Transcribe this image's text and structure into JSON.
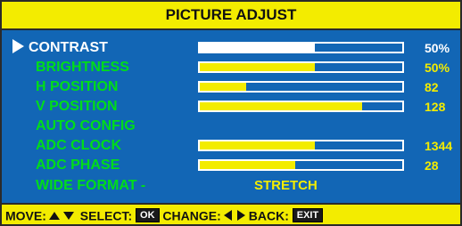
{
  "title": "PICTURE ADJUST",
  "colors": {
    "background": "#1266b5",
    "accent": "#f3ec00",
    "label": "#00dd1a",
    "selected": "#ffffff"
  },
  "menu": {
    "contrast": {
      "label": "CONTRAST",
      "value": "50%",
      "level": 0.57
    },
    "brightness": {
      "label": "BRIGHTNESS",
      "value": "50%",
      "level": 0.57
    },
    "h_position": {
      "label": "H POSITION",
      "value": "82",
      "level": 0.23
    },
    "v_position": {
      "label": "V POSITION",
      "value": "128",
      "level": 0.8
    },
    "auto_config": {
      "label": "AUTO CONFIG"
    },
    "adc_clock": {
      "label": "ADC CLOCK",
      "value": "1344",
      "level": 0.57
    },
    "adc_phase": {
      "label": "ADC PHASE",
      "value": "28",
      "level": 0.47
    },
    "wide_format": {
      "label": "WIDE FORMAT -",
      "value": "STRETCH"
    }
  },
  "footer": {
    "move": "MOVE:",
    "select": "SELECT:",
    "ok_key": "OK",
    "change": "CHANGE:",
    "back": "BACK:",
    "exit_key": "EXIT"
  }
}
